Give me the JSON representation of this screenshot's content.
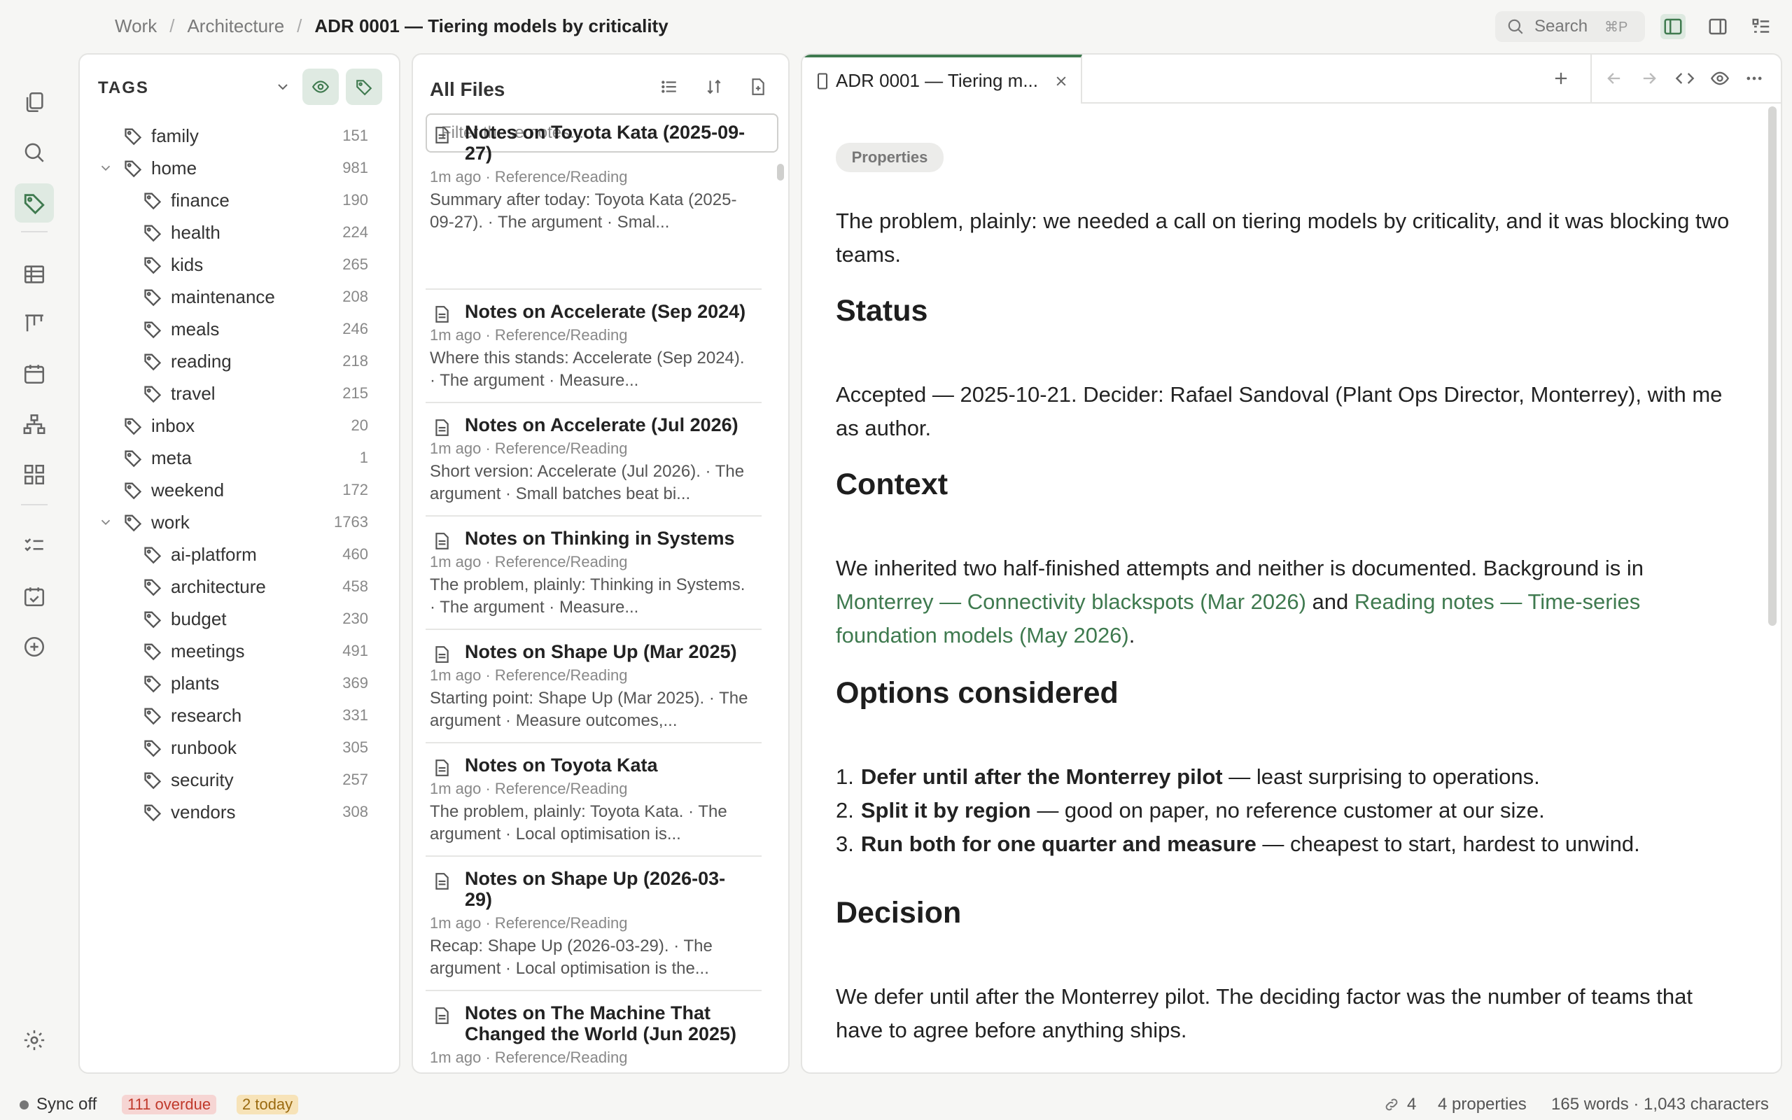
{
  "breadcrumb": {
    "items": [
      "Work",
      "Architecture"
    ],
    "current": "ADR 0001 — Tiering models by criticality"
  },
  "search": {
    "label": "Search",
    "shortcut": "⌘P"
  },
  "tags_panel": {
    "title": "TAGS",
    "tags": [
      {
        "name": "family",
        "count": "151",
        "level": 0
      },
      {
        "name": "home",
        "count": "981",
        "level": 0,
        "expanded": true
      },
      {
        "name": "finance",
        "count": "190",
        "level": 1
      },
      {
        "name": "health",
        "count": "224",
        "level": 1
      },
      {
        "name": "kids",
        "count": "265",
        "level": 1
      },
      {
        "name": "maintenance",
        "count": "208",
        "level": 1
      },
      {
        "name": "meals",
        "count": "246",
        "level": 1
      },
      {
        "name": "reading",
        "count": "218",
        "level": 1
      },
      {
        "name": "travel",
        "count": "215",
        "level": 1
      },
      {
        "name": "inbox",
        "count": "20",
        "level": 0
      },
      {
        "name": "meta",
        "count": "1",
        "level": 0
      },
      {
        "name": "weekend",
        "count": "172",
        "level": 0
      },
      {
        "name": "work",
        "count": "1763",
        "level": 0,
        "expanded": true
      },
      {
        "name": "ai-platform",
        "count": "460",
        "level": 1
      },
      {
        "name": "architecture",
        "count": "458",
        "level": 1
      },
      {
        "name": "budget",
        "count": "230",
        "level": 1
      },
      {
        "name": "meetings",
        "count": "491",
        "level": 1
      },
      {
        "name": "plants",
        "count": "369",
        "level": 1
      },
      {
        "name": "research",
        "count": "331",
        "level": 1
      },
      {
        "name": "runbook",
        "count": "305",
        "level": 1
      },
      {
        "name": "security",
        "count": "257",
        "level": 1
      },
      {
        "name": "vendors",
        "count": "308",
        "level": 1
      }
    ]
  },
  "files_panel": {
    "title": "All Files",
    "filter_placeholder": "Filter these notes...",
    "files": [
      {
        "title": "Notes on Toyota Kata (2025-09-27)",
        "meta": "1m ago · Reference/Reading",
        "summary": "Summary after today: Toyota Kata (2025-09-27). · The argument · Smal..."
      },
      {
        "title": "Notes on Accelerate (Sep 2024)",
        "meta": "1m ago · Reference/Reading",
        "summary": "Where this stands: Accelerate (Sep 2024). · The argument · Measure..."
      },
      {
        "title": "Notes on Accelerate (Jul 2026)",
        "meta": "1m ago · Reference/Reading",
        "summary": "Short version: Accelerate (Jul 2026). · The argument · Small batches beat bi..."
      },
      {
        "title": "Notes on Thinking in Systems",
        "meta": "1m ago · Reference/Reading",
        "summary": "The problem, plainly: Thinking in Systems. · The argument · Measure..."
      },
      {
        "title": "Notes on Shape Up (Mar 2025)",
        "meta": "1m ago · Reference/Reading",
        "summary": "Starting point: Shape Up (Mar 2025). · The argument · Measure outcomes,..."
      },
      {
        "title": "Notes on Toyota Kata",
        "meta": "1m ago · Reference/Reading",
        "summary": "The problem, plainly: Toyota Kata. · The argument · Local optimisation is..."
      },
      {
        "title": "Notes on Shape Up (2026-03-29)",
        "meta": "1m ago · Reference/Reading",
        "summary": "Recap: Shape Up (2026-03-29). · The argument · Local optimisation is the..."
      },
      {
        "title": "Notes on The Machine That Changed the World (Jun 2025)",
        "meta": "1m ago · Reference/Reading",
        "summary": ""
      }
    ]
  },
  "editor": {
    "tab_title": "ADR 0001 — Tiering m...",
    "properties_label": "Properties",
    "intro": "The problem, plainly: we needed a call on tiering models by criticality, and it was blocking two teams.",
    "h_status": "Status",
    "status_text": "Accepted — 2025-10-21. Decider: Rafael Sandoval (Plant Ops Director, Monterrey), with me as author.",
    "h_context": "Context",
    "context_pre": "We inherited two half-finished attempts and neither is documented. Background is in ",
    "context_link1": "Monterrey — Connectivity blackspots (Mar 2026)",
    "context_mid": " and ",
    "context_link2": "Reading notes — Time-series foundation models (May 2026)",
    "context_post": ".",
    "h_options": "Options considered",
    "options": [
      {
        "num": "1.",
        "bold": "Defer until after the Monterrey pilot",
        "rest": " — least surprising to operations."
      },
      {
        "num": "2.",
        "bold": "Split it by region",
        "rest": " — good on paper, no reference customer at our size."
      },
      {
        "num": "3.",
        "bold": "Run both for one quarter and measure",
        "rest": " — cheapest to start, hardest to unwind."
      }
    ],
    "h_decision": "Decision",
    "decision_text": "We defer until after the Monterrey pilot. The deciding factor was the number of teams that have to agree before anything ships."
  },
  "statusbar": {
    "sync": "Sync off",
    "overdue": "111 overdue",
    "today": "2 today",
    "links": "4",
    "properties": "4 properties",
    "counts": "165 words · 1,043 characters"
  },
  "colors": {
    "accent": "#3f7a4f",
    "overdue_bg": "#f6d5d3",
    "overdue_fg": "#c0392b",
    "today_bg": "#f7e3b8",
    "today_fg": "#9a6a10"
  }
}
